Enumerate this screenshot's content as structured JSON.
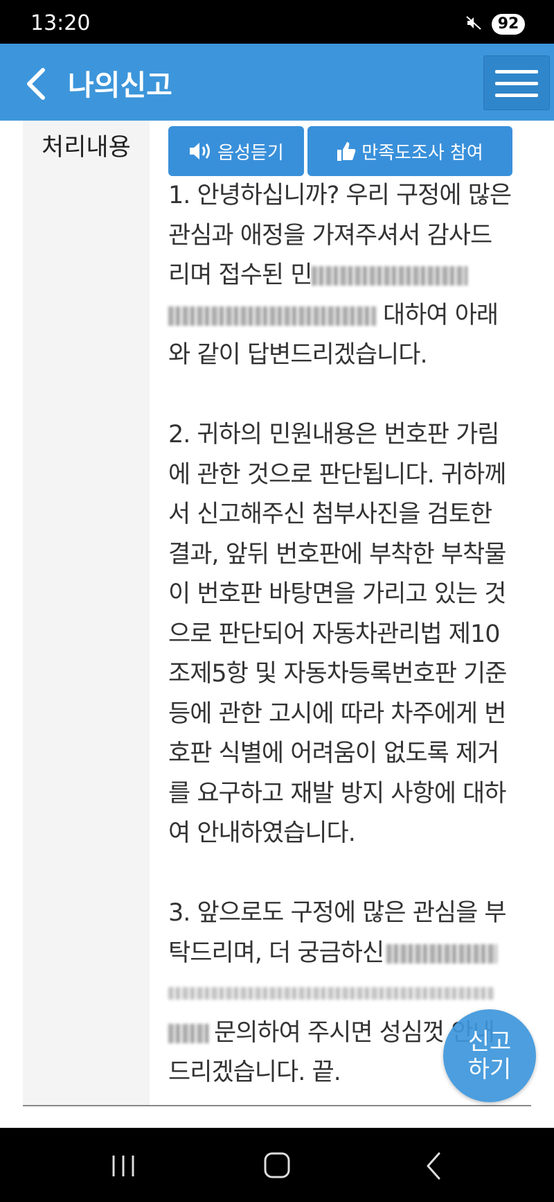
{
  "status_bar": {
    "time": "13:20",
    "battery": "92",
    "mute_icon": "mute-vibrate-icon"
  },
  "header": {
    "title": "나의신고",
    "back_icon": "chevron-left-icon",
    "menu_icon": "hamburger-icon",
    "color": "#3d96db"
  },
  "section": {
    "label": "처리내용",
    "voice_button": "음성듣기",
    "survey_button": "만족도조사 참여"
  },
  "answer": {
    "p1": {
      "line1": "1. 안녕하십니까? 우리 구정에 많은",
      "line2": "관심과 애정을 가져주셔서 감사드",
      "line3": "리며 접수된 민",
      "line4": "대하여 아래",
      "line5": "와 같이 답변드리겠습니다."
    },
    "p2": [
      "2. 귀하의 민원내용은 번호판 가림",
      "에 관한 것으로 판단됩니다. 귀하께",
      "서 신고해주신 첨부사진을 검토한",
      "결과, 앞뒤 번호판에 부착한 부착물",
      "이 번호판 바탕면을 가리고 있는 것",
      "으로 판단되어 자동차관리법 제10",
      "조제5항 및 자동차등록번호판 기준",
      "등에 관한 고시에 따라 차주에게 번",
      "호판 식별에 어려움이 없도록 제거",
      "를 요구하고 재발 방지 사항에 대하",
      "여 안내하였습니다."
    ],
    "p3": {
      "line1": "3. 앞으로도 구정에 많은 관심을 부",
      "line2": "탁드리며, 더 궁금하신",
      "line4": "문의하여 주시면 성심껏 안내",
      "line5": "드리겠습니다. 끝."
    }
  },
  "fab": {
    "line1": "신고",
    "line2": "하기"
  }
}
